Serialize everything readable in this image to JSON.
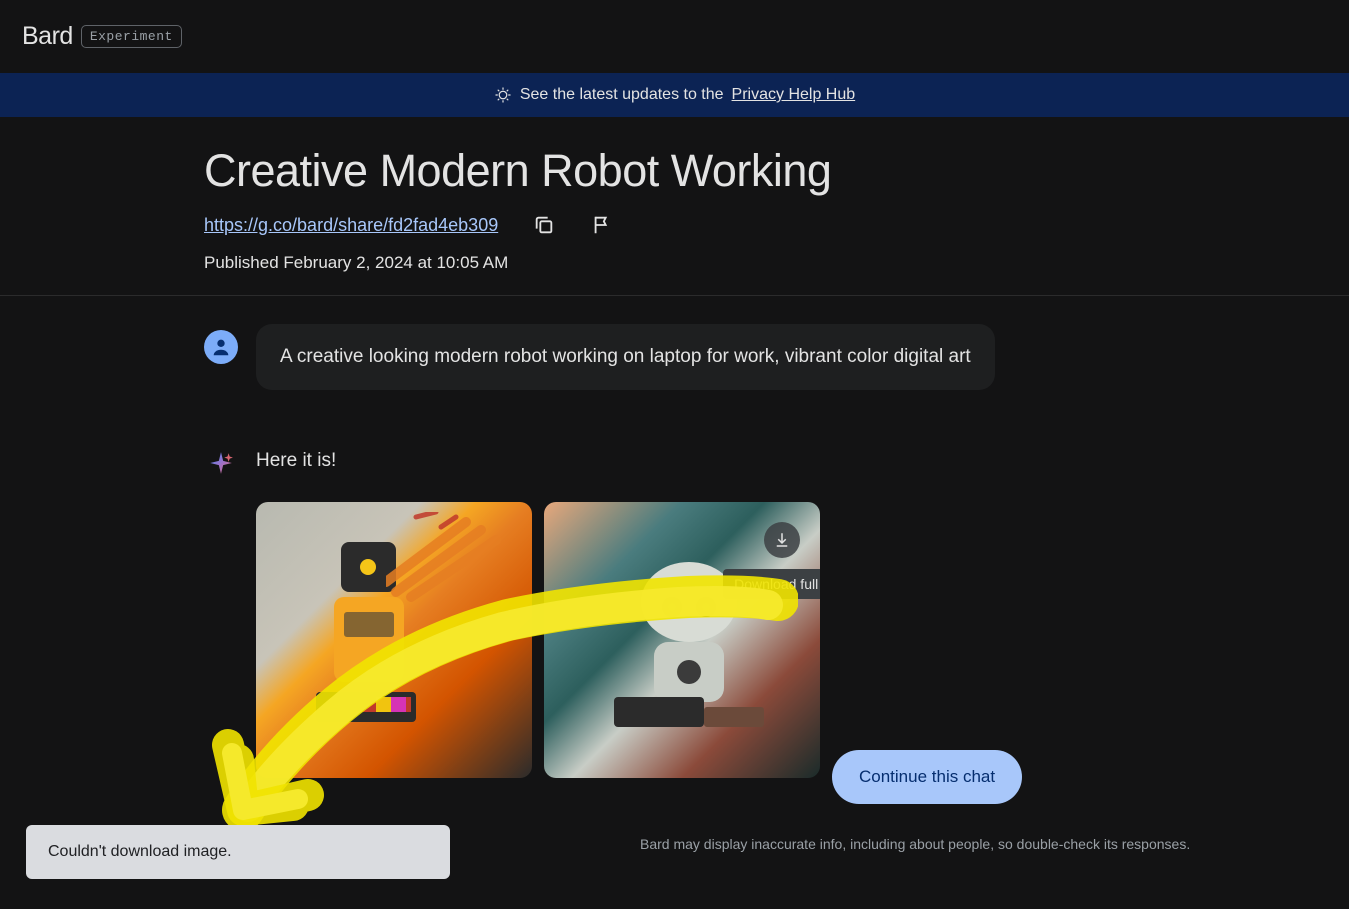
{
  "header": {
    "logo": "Bard",
    "badge": "Experiment"
  },
  "banner": {
    "prefix": "See the latest updates to the ",
    "link": "Privacy Help Hub"
  },
  "title": "Creative Modern Robot Working",
  "share_url": "https://g.co/bard/share/fd2fad4eb309",
  "published": "Published February 2, 2024 at 10:05 AM",
  "user_prompt": "A creative looking modern robot working on laptop for work, vibrant color digital art",
  "bard_reply": "Here it is!",
  "tooltip": "Download full size",
  "continue_label": "Continue this chat",
  "disclaimer": "Bard may display inaccurate info, including about people, so double-check its responses.",
  "toast": "Couldn't download image."
}
